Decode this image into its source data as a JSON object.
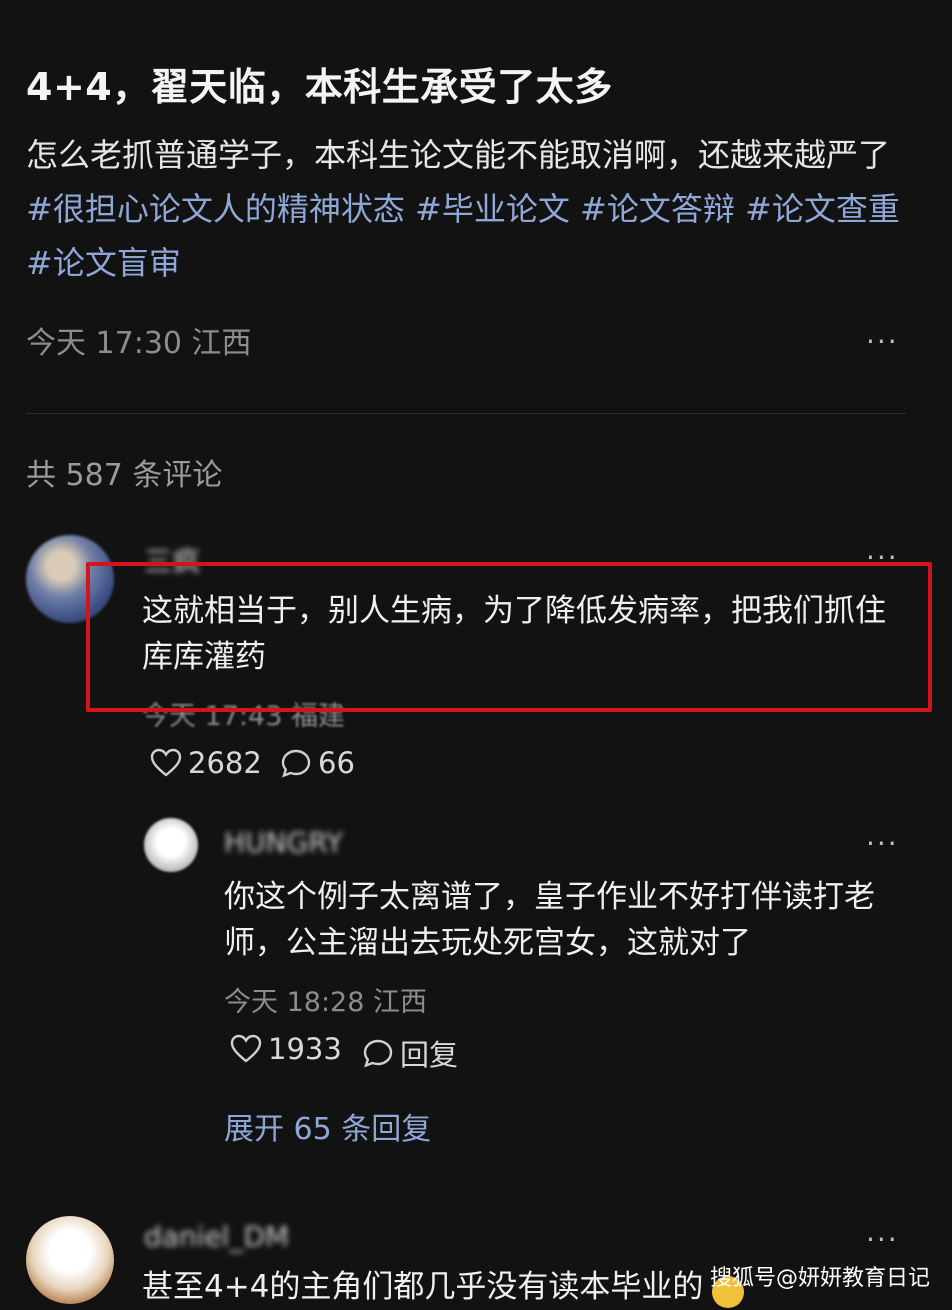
{
  "post": {
    "title": "4+4，翟天临，本科生承受了太多",
    "body_text": "怎么老抓普通学子，本科生论文能不能取消啊，还越来越严了",
    "hashtags": [
      "#很担心论文人的精神状态",
      "#毕业论文",
      "#论文答辩",
      "#论文查重",
      "#论文盲审"
    ],
    "meta": "今天 17:30 江西",
    "more_label": "···"
  },
  "comments_header": {
    "count_label": "共 587 条评论"
  },
  "comments": [
    {
      "username": "三疯",
      "text": "这就相当于，别人生病，为了降低发病率，把我们抓住库库灌药",
      "meta": "今天 17:43 福建",
      "likes": "2682",
      "replies": "66",
      "more_label": "···"
    }
  ],
  "reply": {
    "username": "HUNGRY",
    "text": "你这个例子太离谱了，皇子作业不好打伴读打老师，公主溜出去玩处死宫女，这就对了",
    "meta": "今天 18:28 江西",
    "likes": "1933",
    "reply_label": "回复",
    "more_label": "···",
    "expand_label": "展开 65 条回复"
  },
  "third_comment": {
    "username": "daniel_DM",
    "text": "甚至4+4的主角们都几乎没有读本毕业的",
    "more_label": "···"
  },
  "watermark": "搜狐号@妍妍教育日记",
  "colors": {
    "background": "#121212",
    "hashtag": "#8fa7d6",
    "highlight": "#d4141c"
  }
}
